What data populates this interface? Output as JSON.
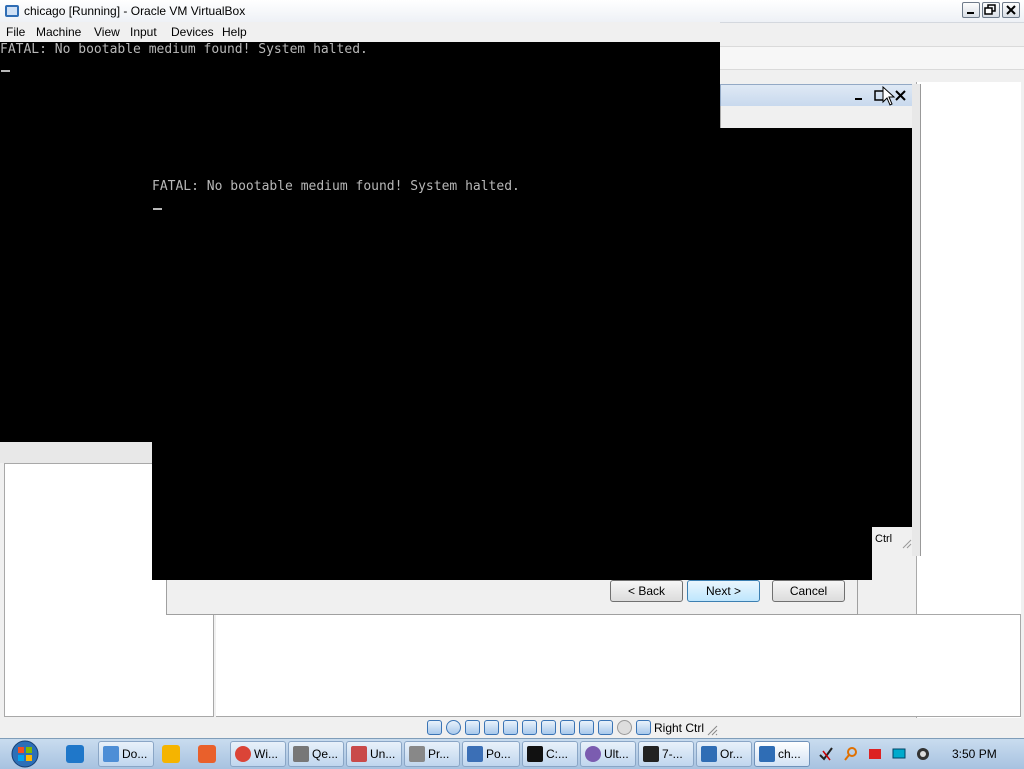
{
  "window": {
    "title": "chicago [Running] - Oracle VM VirtualBox",
    "minimize_icon": "minimize-icon",
    "restore_icon": "restore-icon",
    "close_icon": "close-icon"
  },
  "menubar": {
    "items": [
      {
        "label": "File"
      },
      {
        "label": "Machine"
      },
      {
        "label": "View"
      },
      {
        "label": "Input"
      },
      {
        "label": "Devices"
      },
      {
        "label": "Help"
      }
    ]
  },
  "vm_screen": {
    "message_primary": "FATAL: No bootable medium found! System halted.",
    "message_secondary": "FATAL: No bootable medium found! System halted.",
    "cursor": "_"
  },
  "background_window": {
    "host_key_partial": "Ctrl"
  },
  "wizard": {
    "back_label": "< Back",
    "next_label": "Next >",
    "cancel_label": "Cancel"
  },
  "statusbar": {
    "host_key": "Right Ctrl",
    "icons": [
      "hard-disk-icon",
      "optical-disk-icon",
      "floppy-icon",
      "network-icon",
      "usb-icon",
      "shared-folders-icon",
      "display-icon",
      "video-capture-icon",
      "cpu-icon",
      "mouse-integration-icon",
      "host-key-icon"
    ]
  },
  "taskbar": {
    "items": [
      {
        "label": "Do...",
        "icon": "chrome-doc-icon"
      },
      {
        "label": "Wi...",
        "icon": "chrome-icon"
      },
      {
        "label": "Qe...",
        "icon": "qemu-icon"
      },
      {
        "label": "Un...",
        "icon": "app-icon"
      },
      {
        "label": "Pr...",
        "icon": "app-icon"
      },
      {
        "label": "Po...",
        "icon": "app-icon"
      },
      {
        "label": "C:...",
        "icon": "cmd-icon"
      },
      {
        "label": "Ult...",
        "icon": "app-icon"
      },
      {
        "label": "7-...",
        "icon": "7zip-icon"
      },
      {
        "label": "Or...",
        "icon": "virtualbox-icon"
      },
      {
        "label": "ch...",
        "icon": "virtualbox-vm-icon"
      }
    ],
    "clock": "3:50 PM"
  },
  "colors": {
    "vm_text": "#b8b8b8",
    "vm_background": "#000000",
    "taskbar": "#b5cde8"
  }
}
